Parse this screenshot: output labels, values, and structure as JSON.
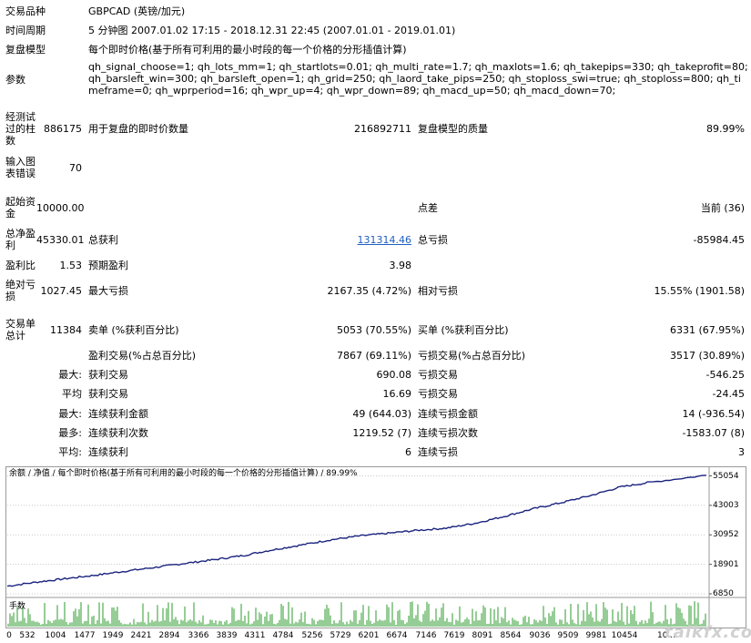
{
  "header": {
    "symbol_label": "交易品种",
    "symbol_value": "GBPCAD (英镑/加元)",
    "period_label": "时间周期",
    "period_value": "5 分钟图 2007.01.02 17:15 - 2018.12.31 22:45 (2007.01.01 - 2019.01.01)",
    "model_label": "复盘模型",
    "model_value": "每个即时价格(基于所有可利用的最小时段的每一个价格的分形插值计算)",
    "params_label": "参数",
    "params_value": "qh_signal_choose=1; qh_lots_mm=1; qh_startlots=0.01; qh_multi_rate=1.7; qh_maxlots=1.6; qh_takepips=330; qh_takeprofit=80; qh_barsleft_win=300; qh_barsleft_open=1; qh_grid=250; qh_laord_take_pips=250; qh_stoploss_swi=true; qh_stoploss=800; qh_timeframe=0; qh_wprperiod=16; qh_wpr_up=4; qh_wpr_down=89; qh_macd_up=50; qh_macd_down=70;"
  },
  "stats": {
    "bars_label": "经测试过的柱数",
    "bars_value": "886175",
    "ticks_label": "用于复盘的即时价数量",
    "ticks_value": "216892711",
    "quality_label": "复盘模型的质量",
    "quality_value": "89.99%",
    "errors_label": "输入图表错误",
    "errors_value": "70",
    "deposit_label": "起始资金",
    "deposit_value": "10000.00",
    "spread_label": "点差",
    "spread_value": "当前 (36)",
    "net_label": "总净盈利",
    "net_value": "45330.01",
    "gross_profit_label": "总获利",
    "gross_profit_value": "131314.46",
    "gross_loss_label": "总亏损",
    "gross_loss_value": "-85984.45",
    "pf_label": "盈利比",
    "pf_value": "1.53",
    "payoff_label": "预期盈利",
    "payoff_value": "3.98",
    "abs_dd_label": "绝对亏损",
    "abs_dd_value": "1027.45",
    "max_dd_label": "最大亏损",
    "max_dd_value": "2167.35 (4.72%)",
    "rel_dd_label": "相对亏损",
    "rel_dd_value": "15.55% (1901.58)",
    "trades_label": "交易单总计",
    "trades_value": "11384",
    "short_label": "卖单 (%获利百分比)",
    "short_value": "5053 (70.55%)",
    "long_label": "买单 (%获利百分比)",
    "long_value": "6331 (67.95%)",
    "win_label": "盈利交易(%占总百分比)",
    "win_value": "7867 (69.11%)",
    "lose_label": "亏损交易(%占总百分比)",
    "lose_value": "3517 (30.89%)",
    "max_prefix": "最大:",
    "avg_prefix": "平均",
    "max2_prefix": "最大:",
    "most_prefix": "最多:",
    "avg2_prefix": "平均:",
    "largest_win_label": "获利交易",
    "largest_win_value": "690.08",
    "largest_loss_label": "亏损交易",
    "largest_loss_value": "-546.25",
    "avg_win_label": "获利交易",
    "avg_win_value": "16.69",
    "avg_loss_label": "亏损交易",
    "avg_loss_value": "-24.45",
    "max_cons_win_amt_label": "连续获利金额",
    "max_cons_win_amt_value": "49 (644.03)",
    "max_cons_loss_amt_label": "连续亏损金额",
    "max_cons_loss_amt_value": "14 (-936.54)",
    "max_cons_win_cnt_label": "连续获利次数",
    "max_cons_win_cnt_value": "1219.52 (7)",
    "max_cons_loss_cnt_label": "连续亏损次数",
    "max_cons_loss_cnt_value": "-1583.07 (8)",
    "avg_cons_win_label": "连续获利",
    "avg_cons_win_value": "6",
    "avg_cons_loss_label": "连续亏损",
    "avg_cons_loss_value": "3"
  },
  "chart": {
    "title": "余额 / 净值 / 每个即时价格(基于所有可利用的最小时段的每一个价格的分形插值计算) / 89.99%",
    "volume_label": "手数",
    "watermark": "talkfx.com"
  },
  "chart_data": {
    "type": "line",
    "ylim": [
      6850,
      56000
    ],
    "yticks": [
      "55054",
      "43003",
      "30952",
      "18901",
      "6850"
    ],
    "xticks": [
      "0",
      "532",
      "1004",
      "1477",
      "1949",
      "2421",
      "2894",
      "3366",
      "3839",
      "4311",
      "4784",
      "5256",
      "5729",
      "6201",
      "6674",
      "7146",
      "7619",
      "8091",
      "8564",
      "9036",
      "9509",
      "9981",
      "10454",
      "10..."
    ],
    "x": [
      0,
      532,
      1004,
      1477,
      1949,
      2421,
      2894,
      3366,
      3839,
      4311,
      4784,
      5256,
      5729,
      6201,
      6674,
      7146,
      7619,
      8091,
      8564,
      9036,
      9509,
      9981,
      10454,
      11384
    ],
    "balance": [
      10000,
      11800,
      13200,
      14600,
      16200,
      17700,
      19300,
      20800,
      22500,
      24800,
      26800,
      28900,
      30500,
      31600,
      32800,
      33700,
      35700,
      38500,
      41600,
      44200,
      47100,
      50500,
      52400,
      55300
    ],
    "colors": {
      "balance": "#1a237e",
      "volume": "#2e9b2e",
      "grid": "#c8c8c8"
    }
  }
}
